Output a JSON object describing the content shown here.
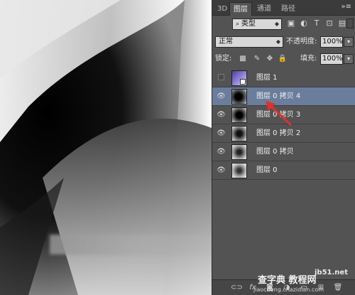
{
  "tabs": [
    "3D",
    "图层",
    "通道",
    "路径"
  ],
  "active_tab_index": 1,
  "panel_menu_icon": "double-chevron-menu-icon",
  "filter": {
    "kind_label": "类型",
    "icons": [
      "image-filter-icon",
      "adjustment-filter-icon",
      "type-filter-icon",
      "shape-filter-icon",
      "smart-object-filter-icon"
    ]
  },
  "blend": {
    "mode": "正常",
    "opacity_label": "不透明度:",
    "opacity_value": "100%"
  },
  "lock": {
    "label": "锁定:",
    "icons": [
      "lock-transparent-icon",
      "lock-pixels-icon",
      "lock-position-icon",
      "lock-all-icon"
    ],
    "fill_label": "填充:",
    "fill_value": "100%"
  },
  "layers": [
    {
      "name": "图层 1",
      "visible": false,
      "selected": false,
      "thumb": "purple"
    },
    {
      "name": "图层 0 拷贝 4",
      "visible": true,
      "selected": true,
      "thumb": "dark"
    },
    {
      "name": "图层 0 拷贝 3",
      "visible": true,
      "selected": false,
      "thumb": "dark"
    },
    {
      "name": "图层 0 拷贝 2",
      "visible": true,
      "selected": false,
      "thumb": "mid"
    },
    {
      "name": "图层 0 拷贝",
      "visible": true,
      "selected": false,
      "thumb": "light"
    },
    {
      "name": "图层 0",
      "visible": true,
      "selected": false,
      "thumb": "light"
    }
  ],
  "bottom_icons": [
    "link-layers-icon",
    "add-style-icon",
    "add-mask-icon",
    "adjustment-layer-icon",
    "new-group-icon",
    "new-layer-icon",
    "delete-layer-icon"
  ],
  "watermark": {
    "line1": "jb51.net",
    "line2": "查字典 教程网",
    "line3": "jiaocheng.chazidian.com"
  },
  "colors": {
    "panel_bg": "#535353",
    "selected_layer": "#6b7d9c",
    "arrow": "#e0302b"
  }
}
